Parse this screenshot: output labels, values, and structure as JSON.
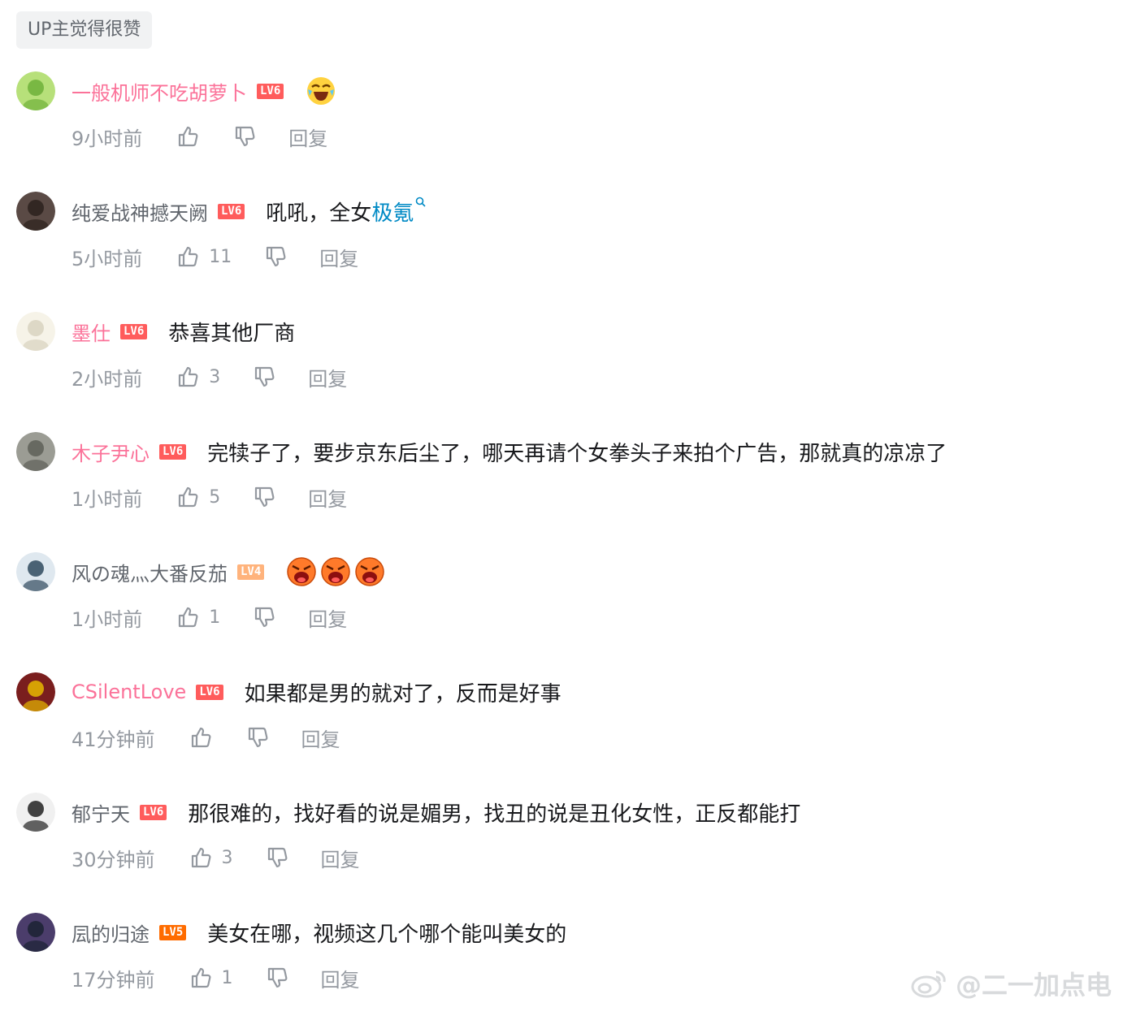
{
  "header": {
    "up_liked_label": "UP主觉得很赞"
  },
  "comments": [
    {
      "username": "一般机师不吃胡萝卜",
      "name_color": "#fb7299",
      "level": "LV6",
      "level_color": "#ff5c5c",
      "content": "",
      "emotes": [
        "laughing-cry-emote"
      ],
      "time": "9小时前",
      "likes": "",
      "reply": "回复"
    },
    {
      "username": "纯爱战神撼天阙",
      "name_color": "#61666d",
      "level": "LV6",
      "level_color": "#ff5c5c",
      "content": "吼吼，全女",
      "keyword": "极氪",
      "time": "5小时前",
      "likes": "11",
      "reply": "回复"
    },
    {
      "username": "墨仕",
      "name_color": "#fb7299",
      "level": "LV6",
      "level_color": "#ff5c5c",
      "content": "恭喜其他厂商",
      "time": "2小时前",
      "likes": "3",
      "reply": "回复"
    },
    {
      "username": "木子尹心",
      "name_color": "#fb7299",
      "level": "LV6",
      "level_color": "#ff5c5c",
      "content": "完犊子了，要步京东后尘了，哪天再请个女拳头子来拍个广告，那就真的凉凉了",
      "time": "1小时前",
      "likes": "5",
      "reply": "回复"
    },
    {
      "username": "风の魂灬大番反茄",
      "name_color": "#61666d",
      "level": "LV4",
      "level_color": "#ffb37c",
      "content": "",
      "emotes": [
        "angry-emote",
        "angry-emote",
        "angry-emote"
      ],
      "time": "1小时前",
      "likes": "1",
      "reply": "回复"
    },
    {
      "username": "CSilentLove",
      "name_color": "#fb7299",
      "level": "LV6",
      "level_color": "#ff5c5c",
      "content": "如果都是男的就对了，反而是好事",
      "time": "41分钟前",
      "likes": "",
      "reply": "回复"
    },
    {
      "username": "郁宁天",
      "name_color": "#61666d",
      "level": "LV6",
      "level_color": "#ff5c5c",
      "content": "那很难的，找好看的说是媚男，找丑的说是丑化女性，正反都能打",
      "time": "30分钟前",
      "likes": "3",
      "reply": "回复"
    },
    {
      "username": "凨的归途",
      "name_color": "#61666d",
      "level": "LV5",
      "level_color": "#ff6c00",
      "content": "美女在哪，视频这几个哪个能叫美女的",
      "time": "17分钟前",
      "likes": "1",
      "reply": "回复"
    }
  ],
  "watermark": {
    "text": "@二一加点电"
  }
}
